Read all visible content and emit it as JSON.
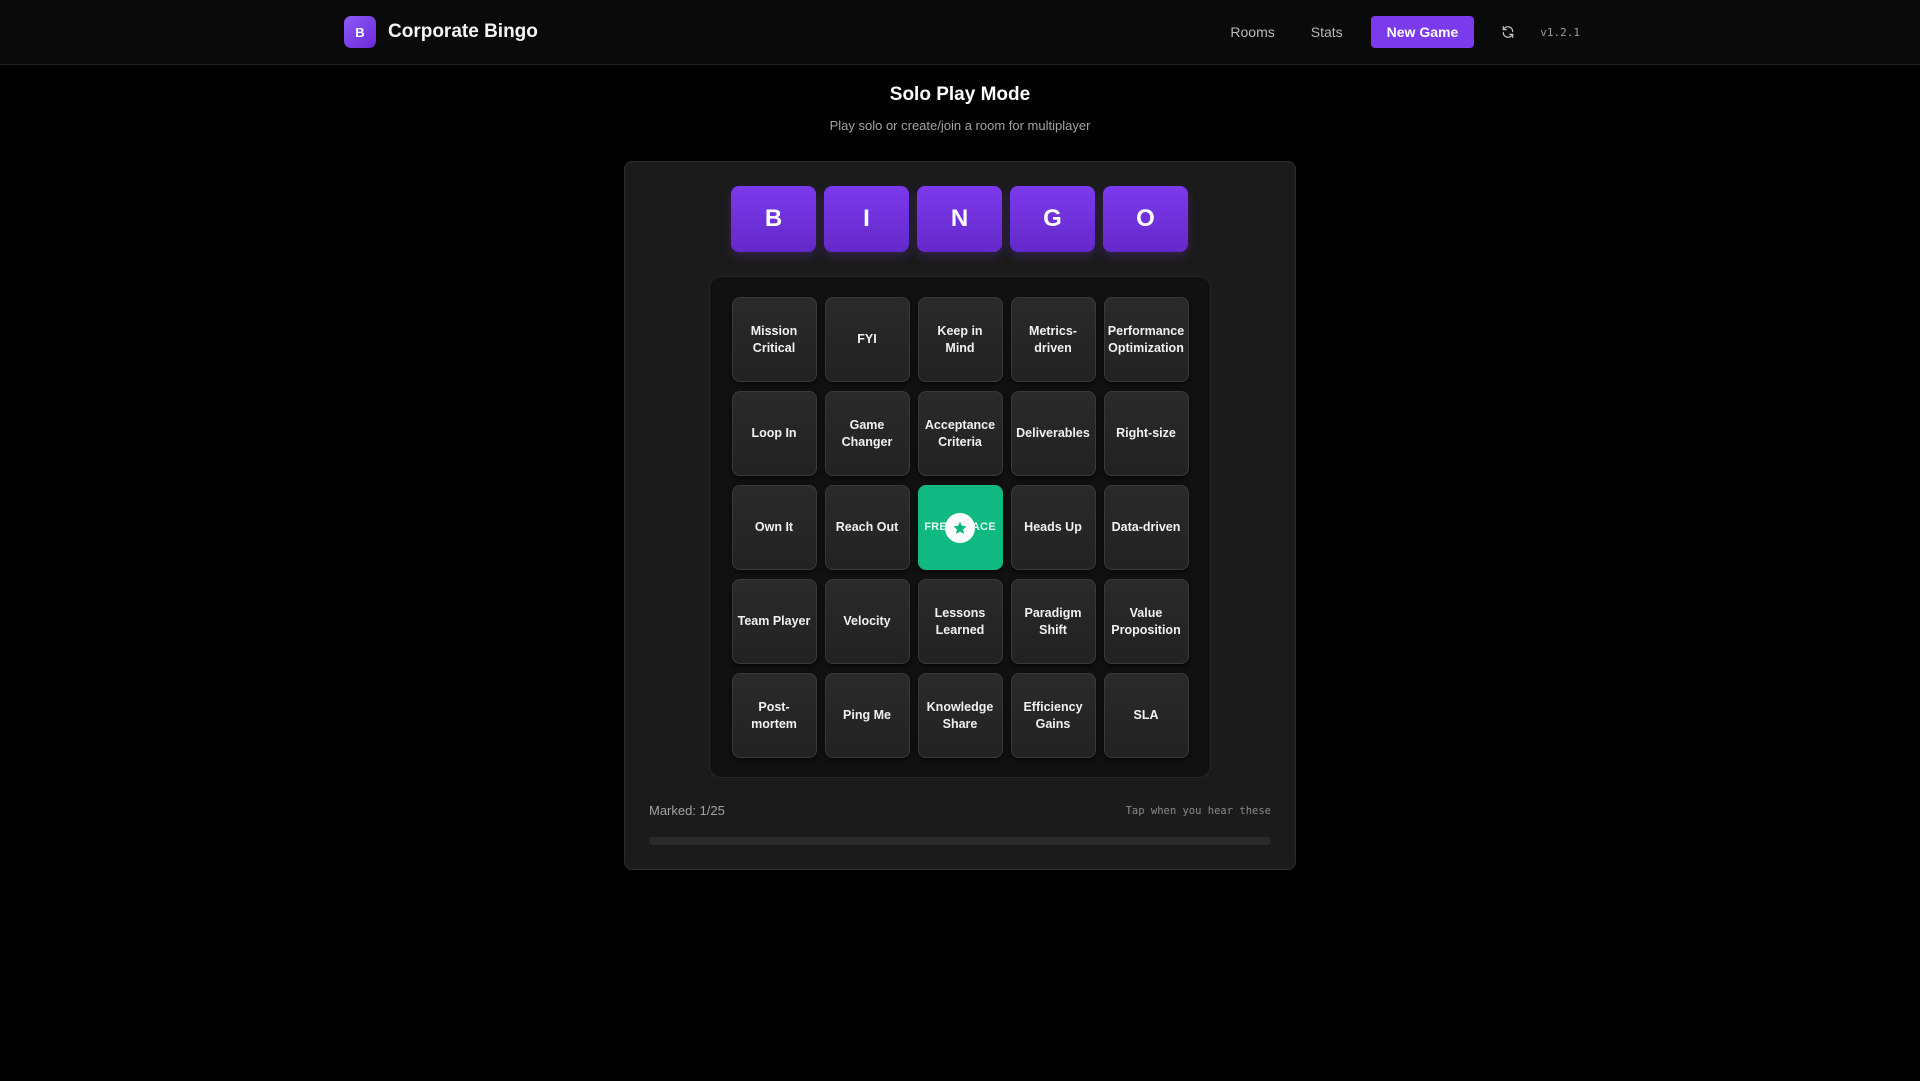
{
  "header": {
    "logo_letter": "B",
    "app_name": "Corporate Bingo",
    "nav": [
      "Rooms",
      "Stats"
    ],
    "new_game_label": "New Game",
    "version": "v1.2.1"
  },
  "page": {
    "title": "Solo Play Mode",
    "subtitle": "Play solo or create/join a room for multiplayer"
  },
  "bingo_letters": [
    "B",
    "I",
    "N",
    "G",
    "O"
  ],
  "board": {
    "cells": [
      {
        "label": "Mission Critical",
        "marked": false
      },
      {
        "label": "FYI",
        "marked": false
      },
      {
        "label": "Keep in Mind",
        "marked": false
      },
      {
        "label": "Metrics-driven",
        "marked": false
      },
      {
        "label": "Performance Optimization",
        "marked": false
      },
      {
        "label": "Loop In",
        "marked": false
      },
      {
        "label": "Game Changer",
        "marked": false
      },
      {
        "label": "Acceptance Criteria",
        "marked": false
      },
      {
        "label": "Deliverables",
        "marked": false
      },
      {
        "label": "Right-size",
        "marked": false
      },
      {
        "label": "Own It",
        "marked": false
      },
      {
        "label": "Reach Out",
        "marked": false
      },
      {
        "label": "FREE SPACE",
        "marked": true,
        "free": true
      },
      {
        "label": "Heads Up",
        "marked": false
      },
      {
        "label": "Data-driven",
        "marked": false
      },
      {
        "label": "Team Player",
        "marked": false
      },
      {
        "label": "Velocity",
        "marked": false
      },
      {
        "label": "Lessons Learned",
        "marked": false
      },
      {
        "label": "Paradigm Shift",
        "marked": false
      },
      {
        "label": "Value Proposition",
        "marked": false
      },
      {
        "label": "Post-mortem",
        "marked": false
      },
      {
        "label": "Ping Me",
        "marked": false
      },
      {
        "label": "Knowledge Share",
        "marked": false
      },
      {
        "label": "Efficiency Gains",
        "marked": false
      },
      {
        "label": "SLA",
        "marked": false
      }
    ]
  },
  "status": {
    "marked_text": "Marked: 1/25",
    "hint": "Tap when you hear these",
    "progress_fraction": 0.0
  },
  "colors": {
    "accent": "#7c3aed",
    "free_space": "#10b981",
    "background": "#000000"
  },
  "icons": {
    "refresh": "refresh-icon",
    "free_space": "star-icon"
  }
}
